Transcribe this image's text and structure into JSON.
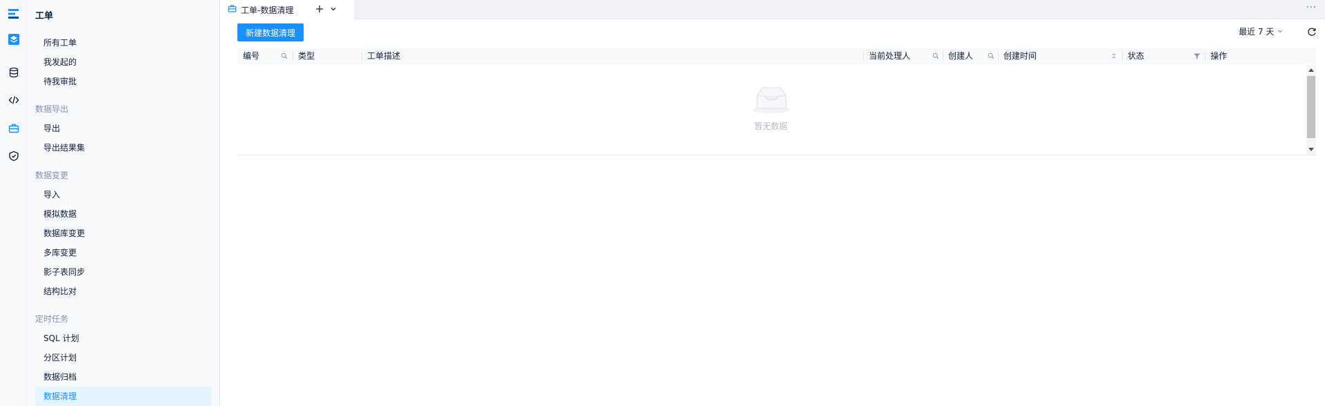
{
  "sidebar": {
    "title": "工单",
    "items_top": [
      "所有工单",
      "我发起的",
      "待我审批"
    ],
    "group_export": "数据导出",
    "items_export": [
      "导出",
      "导出结果集"
    ],
    "group_change": "数据变更",
    "items_change": [
      "导入",
      "模拟数据",
      "数据库变更",
      "多库变更",
      "影子表同步",
      "结构比对"
    ],
    "group_schedule": "定时任务",
    "items_schedule": [
      "SQL 计划",
      "分区计划",
      "数据归档",
      "数据清理"
    ]
  },
  "tab": {
    "label": "工单-数据清理"
  },
  "toolbar": {
    "create_label": "新建数据清理",
    "range_label": "最近 7 天"
  },
  "table": {
    "columns": [
      "编号",
      "类型",
      "工单描述",
      "当前处理人",
      "创建人",
      "创建时间",
      "状态",
      "操作"
    ],
    "empty_text": "暂无数据"
  },
  "colors": {
    "accent": "#1890ff",
    "active_bg": "#e6f4ff"
  },
  "icons": [
    "logo-icon",
    "ticket-icon",
    "database-icon",
    "code-icon",
    "briefcase-icon",
    "shield-icon",
    "briefcase-tab-icon",
    "plus-icon",
    "chevron-down-icon",
    "ellipsis-icon",
    "refresh-icon",
    "search-icon",
    "sort-icon",
    "filter-icon",
    "empty-inbox-icon"
  ]
}
